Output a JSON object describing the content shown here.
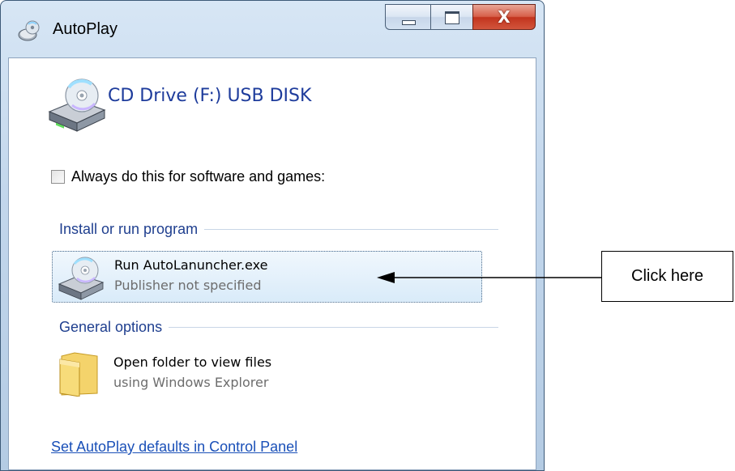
{
  "window": {
    "title": "AutoPlay",
    "title_icon": "autoplay-cd-icon",
    "controls": {
      "minimize_icon": "minimize-icon",
      "maximize_icon": "maximize-icon",
      "close_icon": "close-icon",
      "close_glyph": "X"
    }
  },
  "device": {
    "icon": "cd-drive-icon",
    "title": "CD Drive (F:) USB DISK"
  },
  "always_option": {
    "label": "Always do this for software and games:",
    "checked": false
  },
  "sections": {
    "install": {
      "heading": "Install or run program",
      "items": [
        {
          "icon": "cd-drive-icon",
          "title": "Run AutoLanuncher.exe",
          "subtitle": "Publisher not specified"
        }
      ]
    },
    "general": {
      "heading": "General options",
      "items": [
        {
          "icon": "folder-icon",
          "title": "Open folder to view files",
          "subtitle": "using Windows Explorer"
        }
      ]
    }
  },
  "footer_link": "Set AutoPlay defaults in Control Panel",
  "annotation": {
    "callout_text": "Click here",
    "arrow_icon": "arrow-left-icon"
  },
  "colors": {
    "accent_heading": "#1f3f8f",
    "link": "#1a50b8",
    "device_title": "#1e3c9c",
    "close_button": "#c2341e",
    "selection_bg": "#d9ebf9"
  }
}
